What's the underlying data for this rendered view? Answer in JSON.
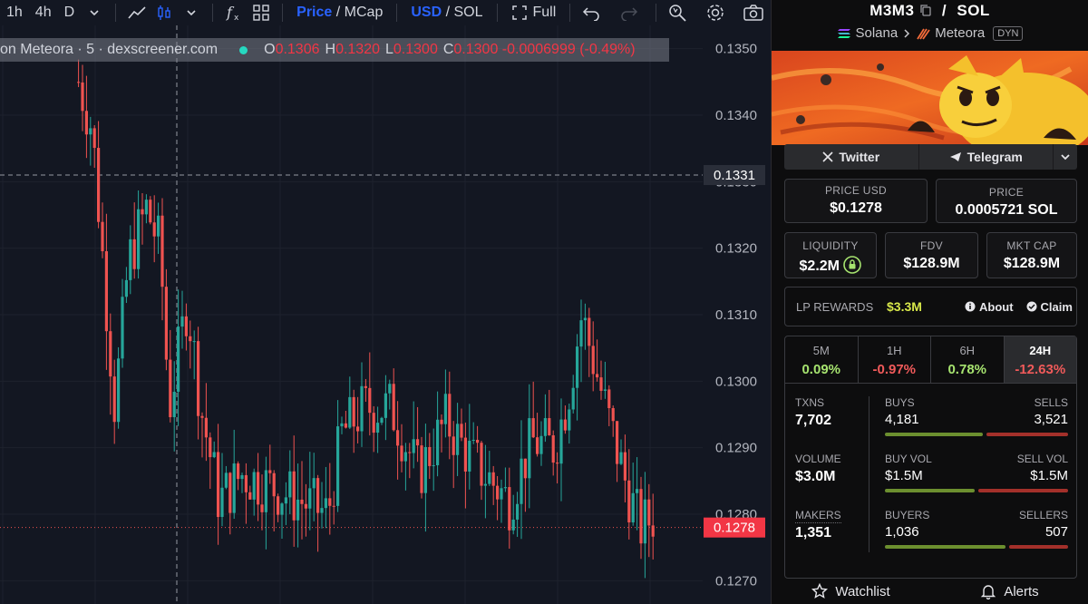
{
  "toolbar": {
    "intervals": [
      "1h",
      "4h",
      "D"
    ],
    "price_label": "Price",
    "mcap_label": "MCap",
    "usd_label": "USD",
    "sol_label": "SOL",
    "full_label": "Full",
    "slash": "/"
  },
  "legend": {
    "title": "on Meteora · 5 · dexscreener.com",
    "o_label": "O",
    "o_value": "0.1306",
    "h_label": "H",
    "h_value": "0.1320",
    "l_label": "L",
    "l_value": "0.1300",
    "c_label": "C",
    "c_value": "0.1300 -0.0006999 (-0.49%)"
  },
  "price_axis": {
    "ticks": [
      "0.1350",
      "0.1340",
      "0.1330",
      "0.1320",
      "0.1310",
      "0.1300",
      "0.1290",
      "0.1280",
      "0.1270"
    ],
    "crosshair_label": "0.1331",
    "last_price_label": "0.1278"
  },
  "chart_data": {
    "type": "candlestick",
    "y_range": [
      0.12665,
      0.13535
    ],
    "crosshair_price": 0.1331,
    "last_price": 0.1278,
    "colors": {
      "up": "#26a69a",
      "down": "#ef5350"
    }
  },
  "pair": {
    "base": "M3M3",
    "quote": "SOL",
    "slash": "/",
    "chain": "Solana",
    "dex": "Meteora",
    "tag": "DYN"
  },
  "socials": {
    "twitter": "Twitter",
    "telegram": "Telegram"
  },
  "metrics": {
    "price_usd_label": "PRICE USD",
    "price_usd": "$0.1278",
    "price_label": "PRICE",
    "price": "0.0005721 SOL",
    "liquidity_label": "LIQUIDITY",
    "liquidity": "$2.2M",
    "fdv_label": "FDV",
    "fdv": "$128.9M",
    "mktcap_label": "MKT CAP",
    "mktcap": "$128.9M"
  },
  "lp": {
    "label": "LP REWARDS",
    "value": "$3.3M",
    "about": "About",
    "claim": "Claim"
  },
  "timeframes": [
    {
      "label": "5M",
      "value": "0.09%"
    },
    {
      "label": "1H",
      "value": "-0.97%"
    },
    {
      "label": "6H",
      "value": "0.78%"
    },
    {
      "label": "24H",
      "value": "-12.63%"
    }
  ],
  "stats": {
    "txns_label": "TXNS",
    "txns": "7,702",
    "buys_label": "BUYS",
    "buys": "4,181",
    "sells_label": "SELLS",
    "sells": "3,521",
    "volume_label": "VOLUME",
    "volume": "$3.0M",
    "buy_vol_label": "BUY VOL",
    "buy_vol": "$1.5M",
    "sell_vol_label": "SELL VOL",
    "sell_vol": "$1.5M",
    "makers_label": "MAKERS",
    "makers": "1,351",
    "buyers_label": "BUYERS",
    "buyers": "1,036",
    "sellers_label": "SELLERS",
    "sellers": "507",
    "buy_share": 0.543,
    "buy_vol_share": 0.5,
    "buyer_share": 0.671
  },
  "footer": {
    "watchlist": "Watchlist",
    "alerts": "Alerts"
  }
}
